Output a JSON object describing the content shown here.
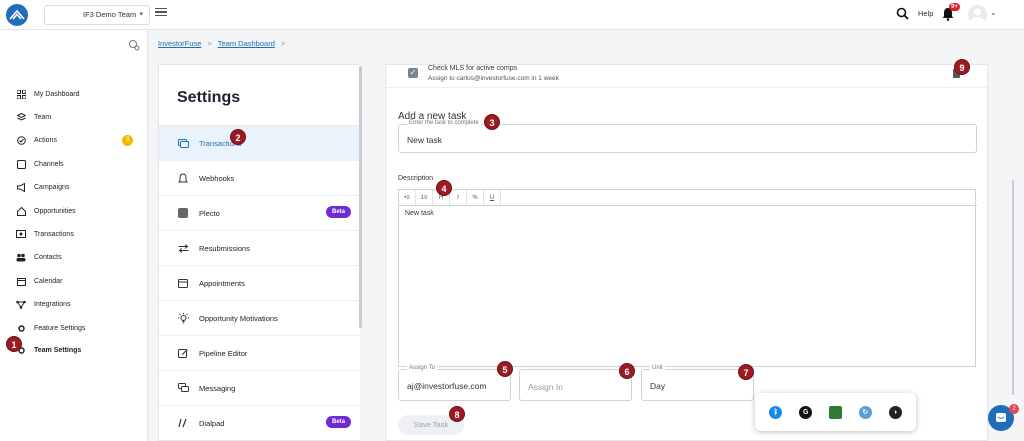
{
  "topbar": {
    "team_name": "IF3 Demo Team",
    "help_label": "Help",
    "notification_count": "9+"
  },
  "leftnav": {
    "items": [
      {
        "label": "My Dashboard",
        "icon": "grid-icon"
      },
      {
        "label": "Team",
        "icon": "stack-icon"
      },
      {
        "label": "Actions",
        "icon": "check-circle-icon"
      },
      {
        "label": "Channels",
        "icon": "puzzle-icon"
      },
      {
        "label": "Campaigns",
        "icon": "megaphone-icon"
      },
      {
        "label": "Opportunities",
        "icon": "home-icon"
      },
      {
        "label": "Transactions",
        "icon": "cash-icon"
      },
      {
        "label": "Contacts",
        "icon": "people-icon"
      },
      {
        "label": "Calendar",
        "icon": "calendar-icon"
      },
      {
        "label": "Integrations",
        "icon": "network-icon"
      },
      {
        "label": "Feature Settings",
        "icon": "gear-cog-icon"
      },
      {
        "label": "Team Settings",
        "icon": "gear-icon"
      }
    ],
    "actions_badge": "3"
  },
  "breadcrumb": {
    "items": [
      "InvestorFuse",
      "Team Dashboard"
    ],
    "separator": ">"
  },
  "settings": {
    "title": "Settings",
    "items": [
      {
        "label": "Transactions",
        "icon": "money-icon"
      },
      {
        "label": "Webhooks",
        "icon": "bell-icon"
      },
      {
        "label": "Plecto",
        "icon": "plecto-icon",
        "badge": "Beta"
      },
      {
        "label": "Resubmissions",
        "icon": "arrows-icon"
      },
      {
        "label": "Appointments",
        "icon": "calendar-icon"
      },
      {
        "label": "Opportunity Motivations",
        "icon": "bulb-icon"
      },
      {
        "label": "Pipeline Editor",
        "icon": "edit-icon"
      },
      {
        "label": "Messaging",
        "icon": "chat-icon"
      },
      {
        "label": "Dialpad",
        "icon": "dialpad-icon",
        "badge": "Beta"
      }
    ]
  },
  "task": {
    "title": "Check MLS for active comps",
    "subtitle": "Assign to carlos@investorfuse.com in 1 week"
  },
  "form": {
    "heading": "Add a new task",
    "task_legend": "Enter the task to complete",
    "task_value": "New task",
    "description_label": "Description",
    "editor_text": "New task",
    "toolbar": [
      "•≡",
      "1≡",
      "H",
      "I",
      "%",
      "U"
    ],
    "assign_legend": "Assign To",
    "assign_value": "aj@investorfuse.com",
    "assign_in_placeholder": "Assign In",
    "unit_legend": "Unit",
    "unit_value": "Day",
    "save_label": "Save Task"
  },
  "markers": [
    "1",
    "2",
    "3",
    "4",
    "5",
    "6",
    "7",
    "8",
    "9"
  ],
  "tray": {
    "icons": [
      "bluetooth-icon",
      "grammarly-icon",
      "nvidia-icon",
      "sync-icon",
      "extension-icon"
    ]
  },
  "chat": {
    "badge": "2"
  },
  "colors": {
    "brand": "#1e6fb8",
    "marker": "#9c1b22",
    "beta": "#6f2bd6",
    "badge_red": "#d9232e",
    "badge_yellow": "#f5b800"
  }
}
